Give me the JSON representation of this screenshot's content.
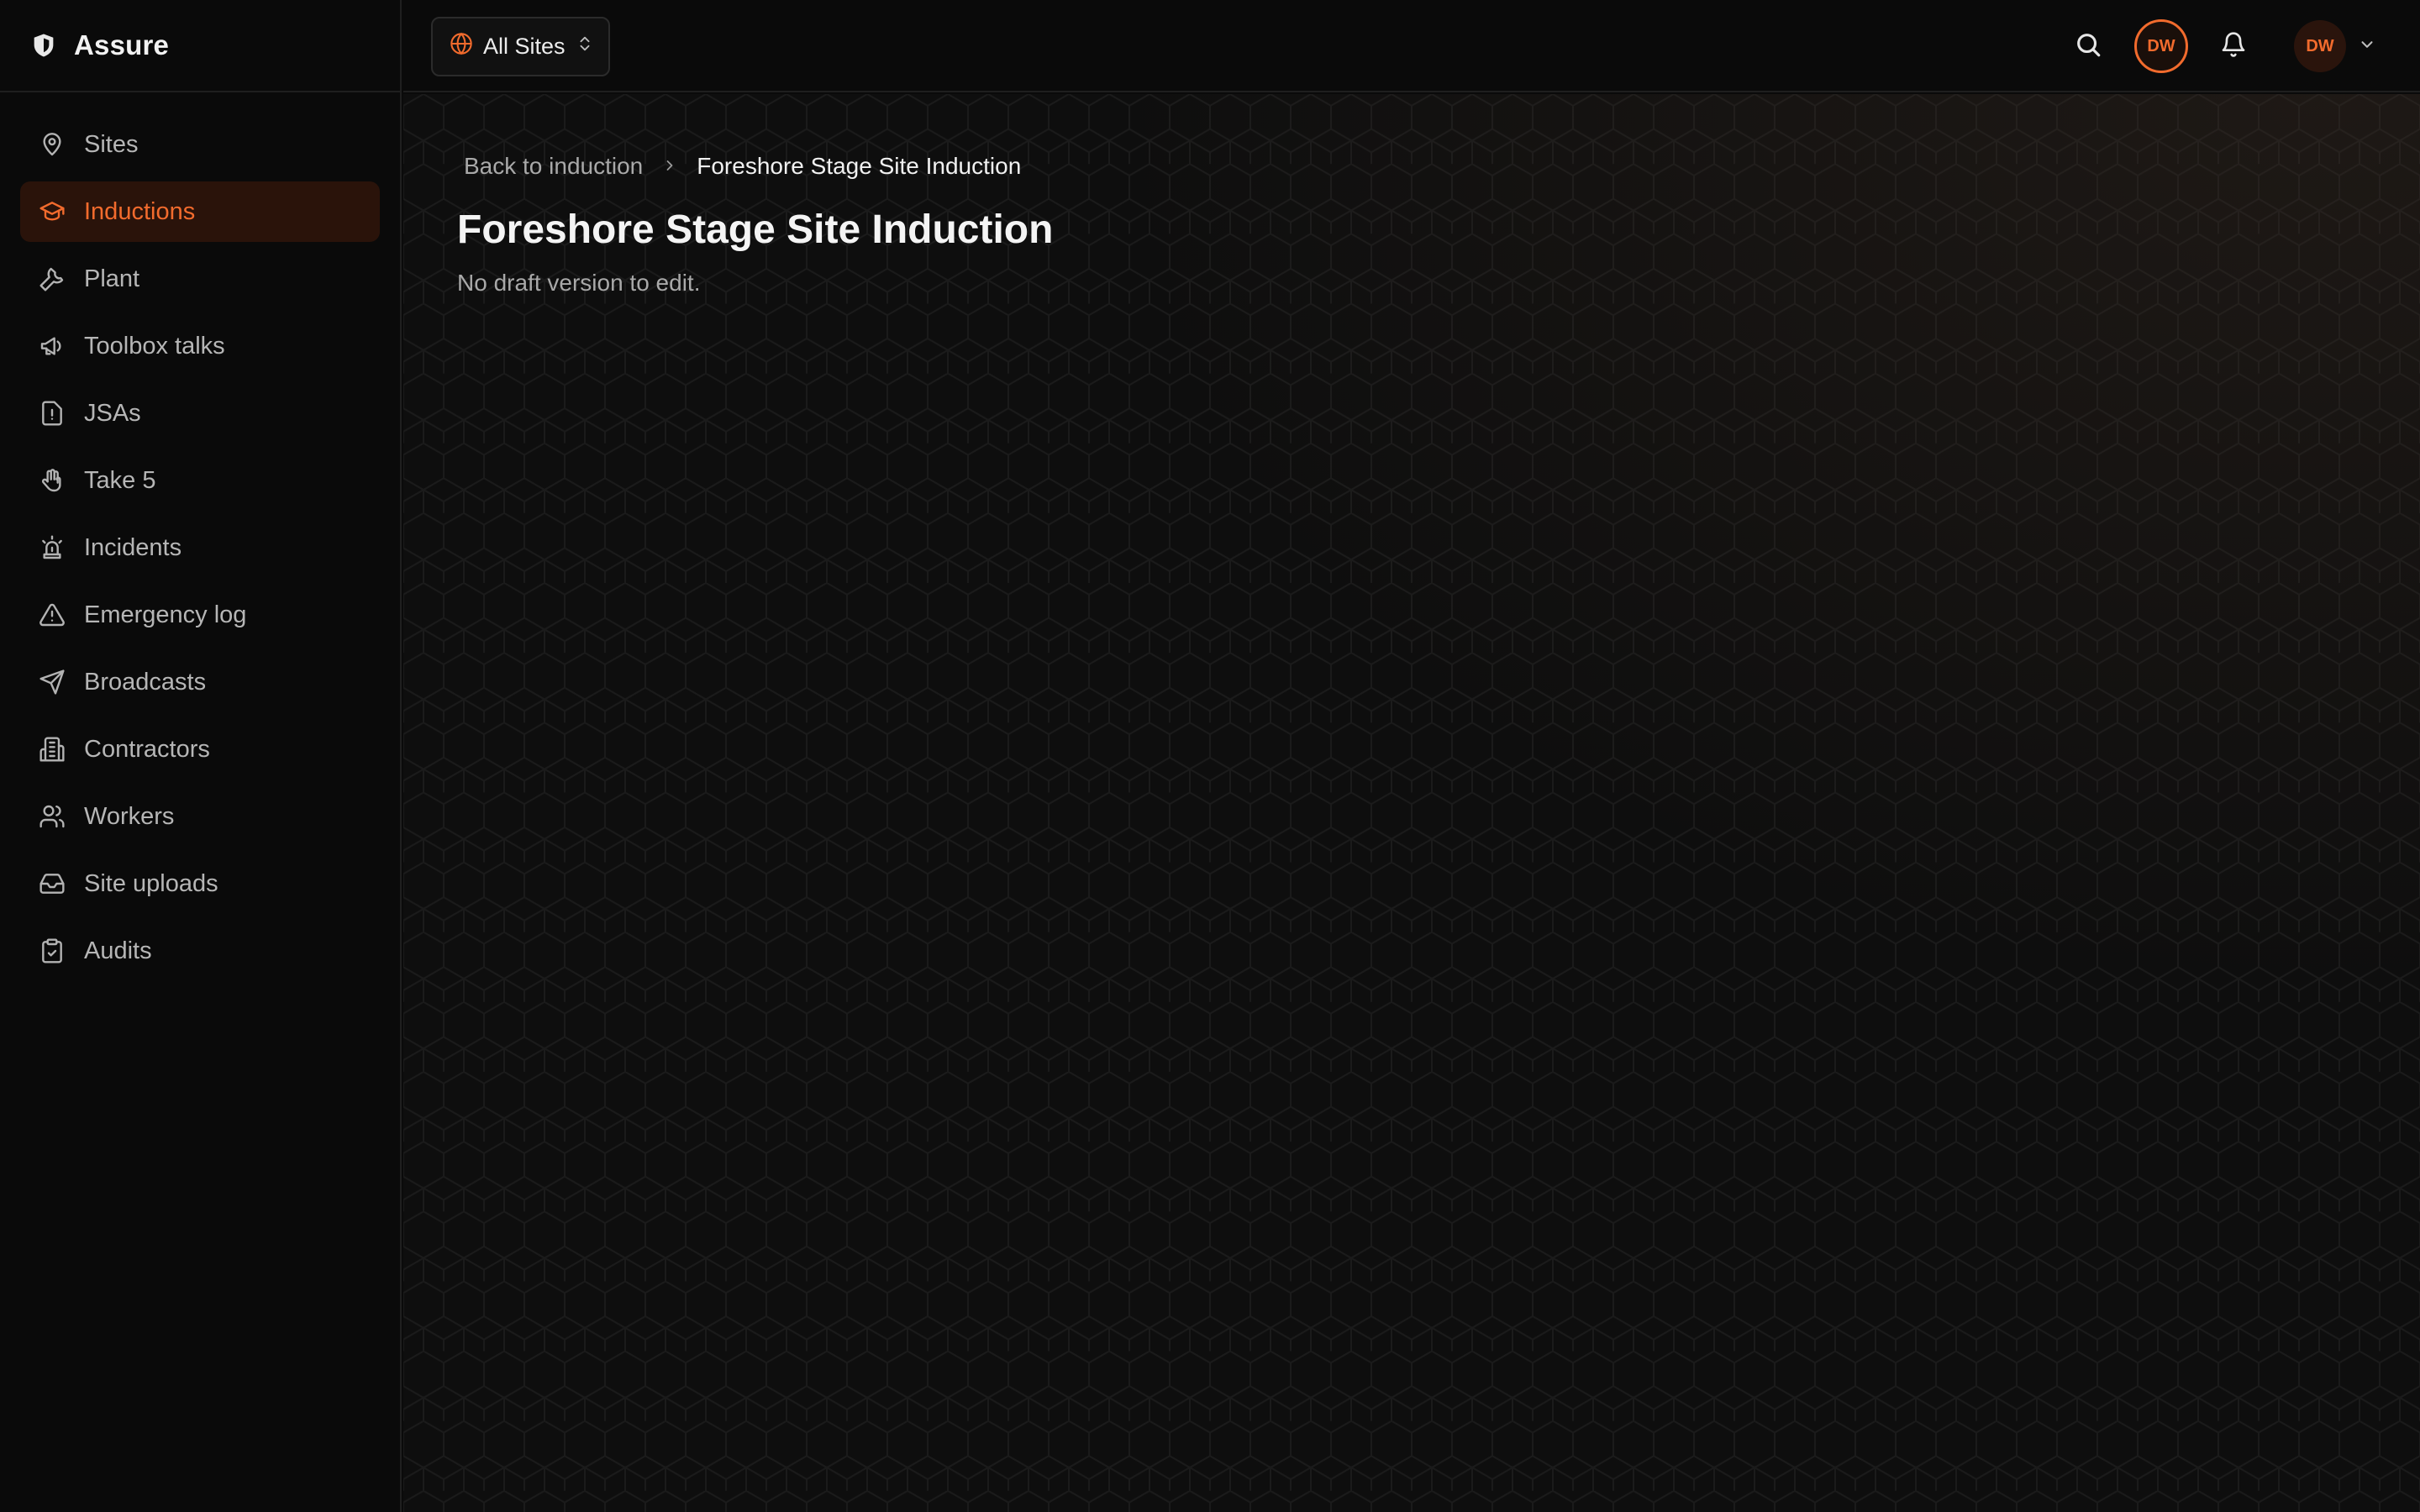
{
  "app": {
    "name": "Assure"
  },
  "colors": {
    "accent": "#f26b2d",
    "active_bg": "#2a130a",
    "background": "#0a0a0a"
  },
  "sidebar": {
    "items": [
      {
        "label": "Sites",
        "icon": "map-pin-icon",
        "active": false
      },
      {
        "label": "Inductions",
        "icon": "graduation-cap-icon",
        "active": true
      },
      {
        "label": "Plant",
        "icon": "wrench-icon",
        "active": false
      },
      {
        "label": "Toolbox talks",
        "icon": "megaphone-icon",
        "active": false
      },
      {
        "label": "JSAs",
        "icon": "file-alert-icon",
        "active": false
      },
      {
        "label": "Take 5",
        "icon": "hand-icon",
        "active": false
      },
      {
        "label": "Incidents",
        "icon": "siren-icon",
        "active": false
      },
      {
        "label": "Emergency log",
        "icon": "warning-triangle-icon",
        "active": false
      },
      {
        "label": "Broadcasts",
        "icon": "send-icon",
        "active": false
      },
      {
        "label": "Contractors",
        "icon": "building-icon",
        "active": false
      },
      {
        "label": "Workers",
        "icon": "users-icon",
        "active": false
      },
      {
        "label": "Site uploads",
        "icon": "inbox-icon",
        "active": false
      },
      {
        "label": "Audits",
        "icon": "clipboard-check-icon",
        "active": false
      }
    ]
  },
  "topbar": {
    "site_selector": "All Sites",
    "avatar_initials": "DW",
    "user_initials": "DW"
  },
  "breadcrumb": {
    "back_label": "Back to induction",
    "current": "Foreshore Stage Site Induction"
  },
  "page": {
    "title": "Foreshore Stage Site Induction",
    "subtitle": "No draft version to edit."
  }
}
